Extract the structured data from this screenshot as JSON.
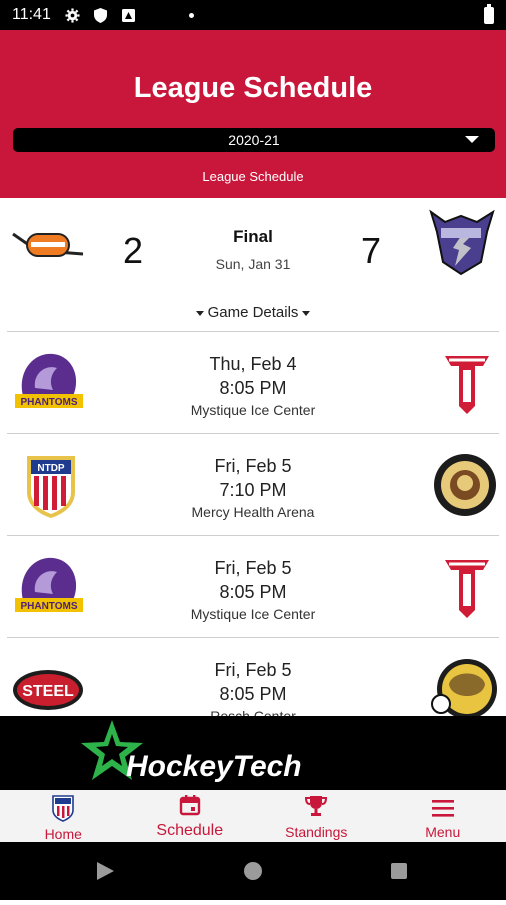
{
  "status_bar": {
    "time": "11:41"
  },
  "header": {
    "title": "League Schedule",
    "season": "2020-21",
    "subtitle": "League Schedule"
  },
  "final_game": {
    "home_score": "2",
    "away_score": "7",
    "status": "Final",
    "date": "Sun, Jan 31",
    "details_label": "Game Details"
  },
  "games": [
    {
      "date": "Thu, Feb 4",
      "time": "8:05 PM",
      "venue": "Mystique Ice Center"
    },
    {
      "date": "Fri, Feb 5",
      "time": "7:10 PM",
      "venue": "Mercy Health Arena"
    },
    {
      "date": "Fri, Feb 5",
      "time": "8:05 PM",
      "venue": "Mystique Ice Center"
    },
    {
      "date": "Fri, Feb 5",
      "time": "8:05 PM",
      "venue": "Resch Center"
    }
  ],
  "logos": {
    "ntdp_text": "NTDP",
    "steel_text": "STEEL",
    "phantoms_text": "PHANTOMS",
    "hockeytech_text": "HockeyTech"
  },
  "nav": [
    {
      "label": "Home"
    },
    {
      "label": "Schedule"
    },
    {
      "label": "Standings"
    },
    {
      "label": "Menu"
    }
  ],
  "colors": {
    "accent": "#c8173a",
    "header_bg": "#c8173a",
    "banner_bg": "#000000",
    "hockeytech_green": "#2db34a"
  }
}
